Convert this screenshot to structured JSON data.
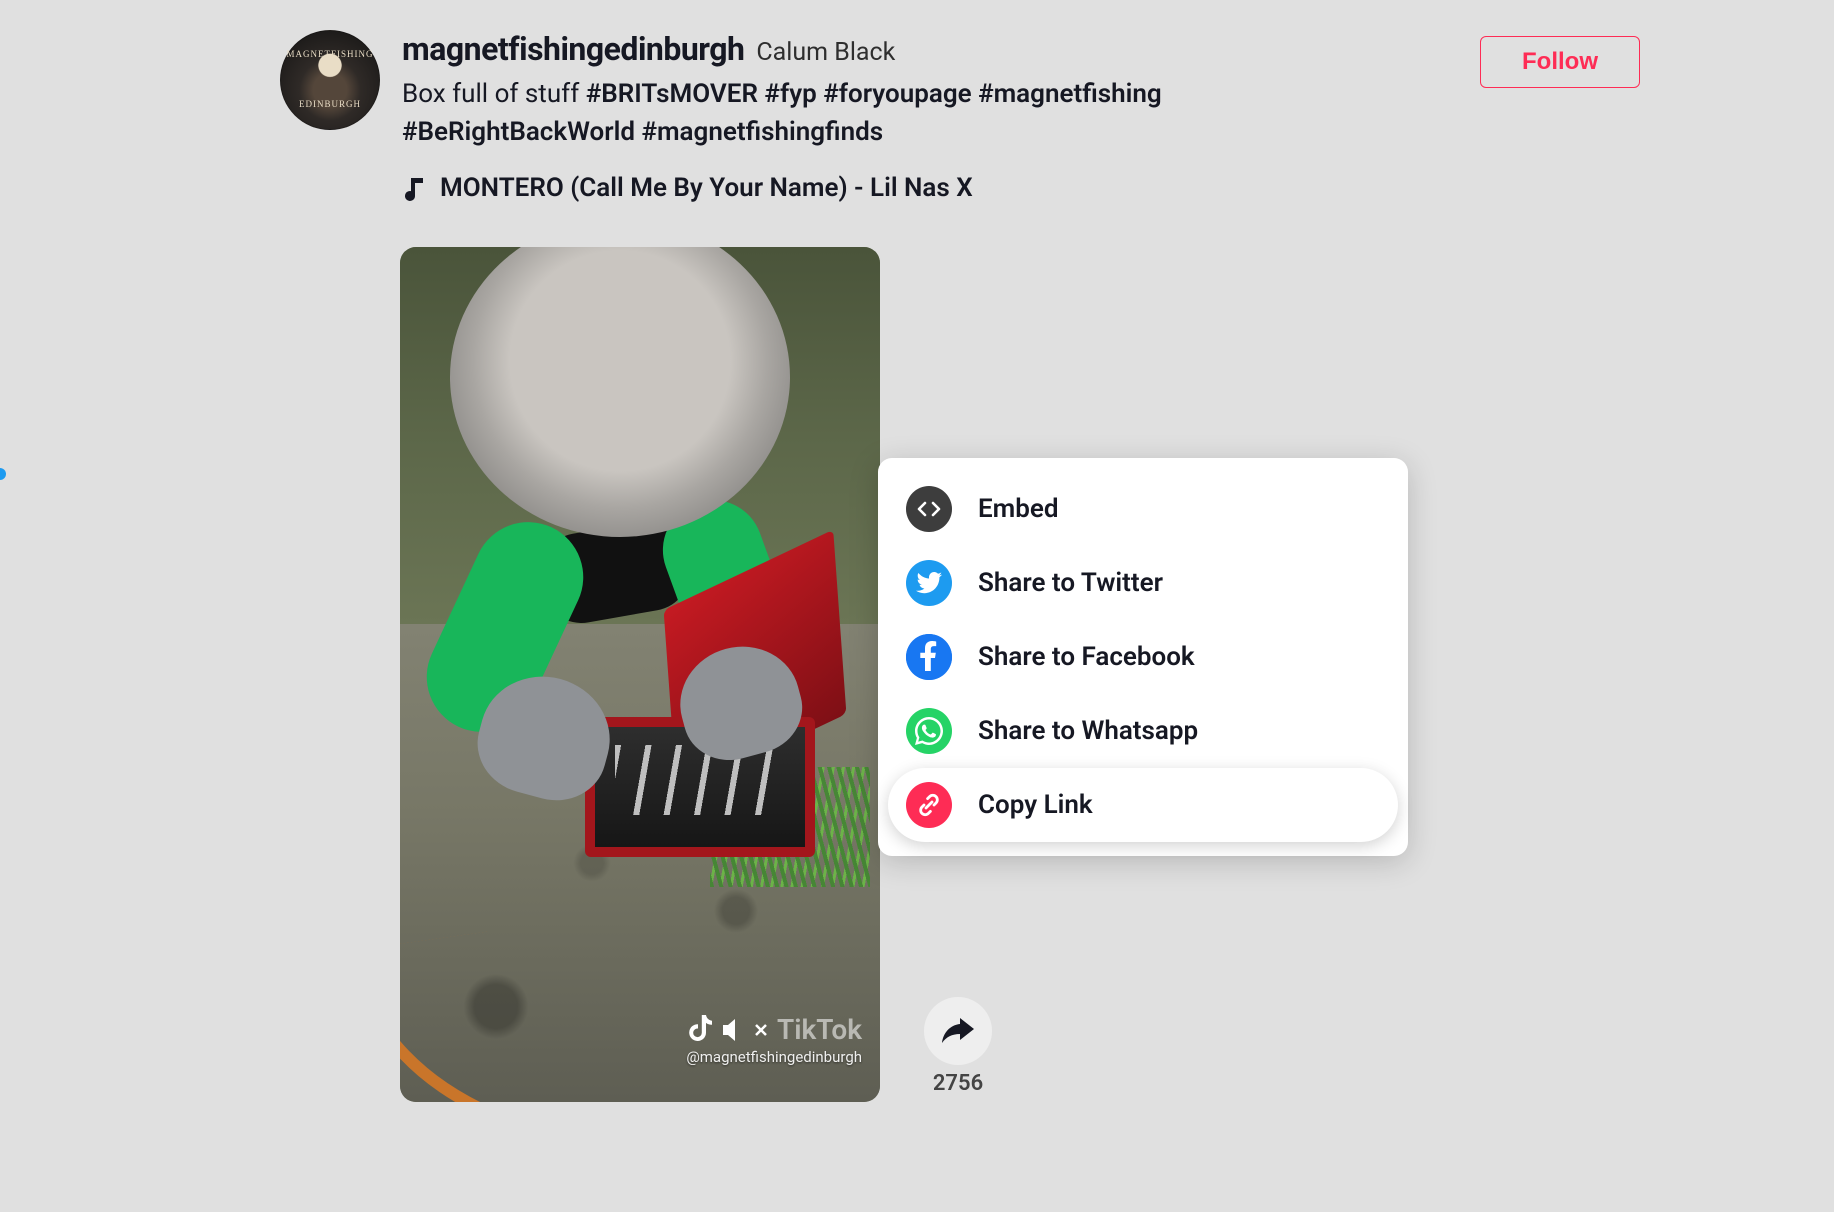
{
  "avatar": {
    "line1": "MAGNETFISHING",
    "line2": "EDINBURGH"
  },
  "profile": {
    "username": "magnetfishingedinburgh",
    "display_name": "Calum Black",
    "caption_text": "Box full of stuff ",
    "hashtags": [
      "#BRITsMOVER",
      "#fyp",
      "#foryoupage",
      "#magnetfishing",
      "#BeRightBackWorld",
      "#magnetfishingfinds"
    ],
    "music": "MONTERO (Call Me By Your Name) - Lil Nas X",
    "follow_label": "Follow"
  },
  "watermark": {
    "brand": "TikTok",
    "handle": "@magnetfishingedinburgh"
  },
  "actions": {
    "share_count": "2756"
  },
  "share_menu": {
    "embed": "Embed",
    "twitter": "Share to Twitter",
    "facebook": "Share to Facebook",
    "whatsapp": "Share to Whatsapp",
    "copy_link": "Copy Link"
  }
}
